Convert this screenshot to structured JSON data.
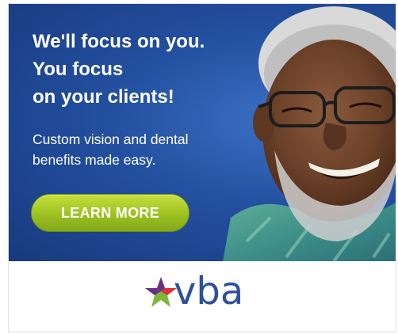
{
  "ad": {
    "headline_lines": [
      "We'll focus on you.",
      "You focus",
      "on your clients!"
    ],
    "subline_lines": [
      "Custom vision and dental",
      "benefits made easy."
    ],
    "cta_label": "LEARN MORE",
    "logo_text": "vba",
    "colors": {
      "hero_blue": "#234f9f",
      "cta_green": "#9cc121",
      "logo_blue": "#2d4f9c",
      "logo_star_purple": "#6b2f86",
      "logo_star_green": "#7fb53a",
      "logo_star_red": "#d8323c"
    },
    "photo_subject": "smiling-man-with-glasses"
  }
}
